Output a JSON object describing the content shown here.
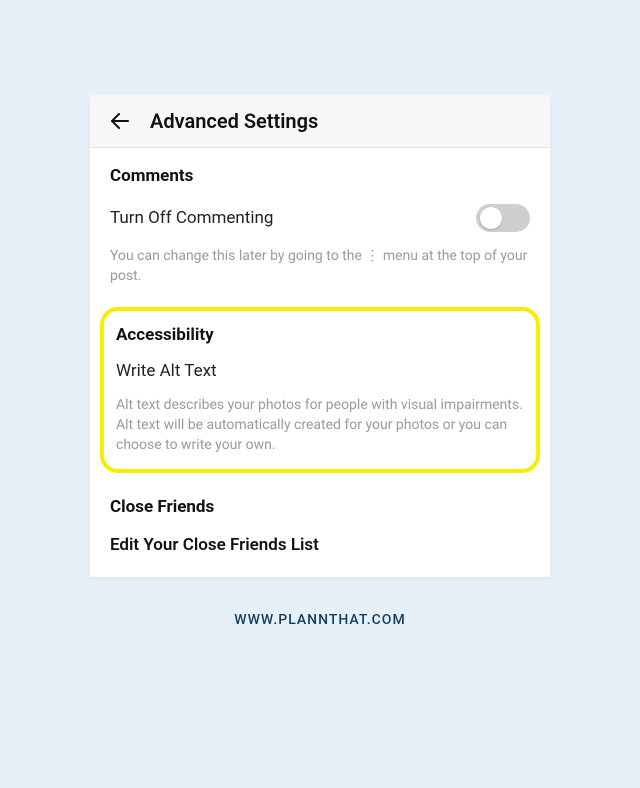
{
  "header": {
    "title": "Advanced Settings"
  },
  "comments": {
    "heading": "Comments",
    "toggleLabel": "Turn Off Commenting",
    "description": "You can change this later by going to the ⋮ menu at the top of your post."
  },
  "accessibility": {
    "heading": "Accessibility",
    "action": "Write Alt Text",
    "description": "Alt text describes your photos for people with visual impairments. Alt text will be automatically created for your photos or you can choose to write your own."
  },
  "closeFriends": {
    "heading": "Close Friends",
    "action": "Edit Your Close Friends List"
  },
  "footer": {
    "url": "WWW.PLANNTHAT.COM"
  }
}
